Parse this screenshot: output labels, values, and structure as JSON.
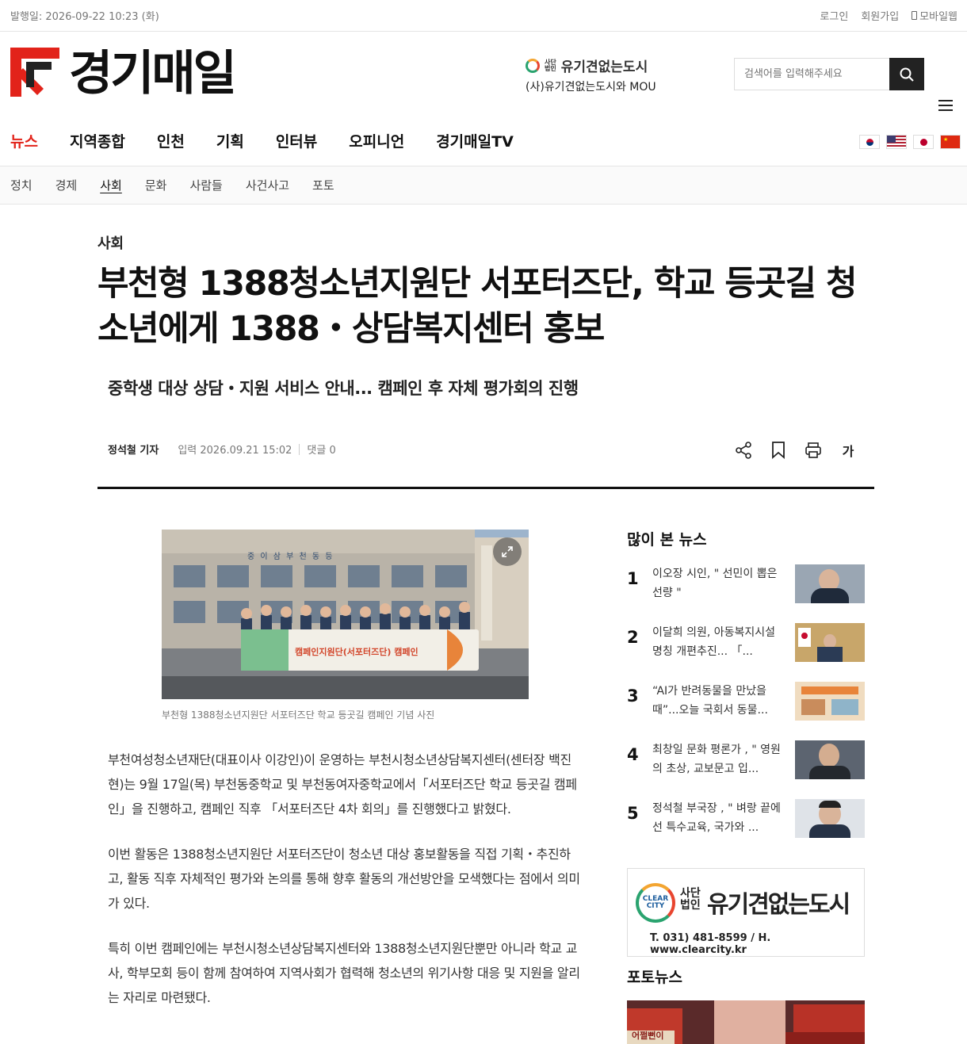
{
  "topbar": {
    "date": "발행일: 2026-09-22 10:23 (화)",
    "login": "로그인",
    "signup": "회원가입",
    "mobile": "모바일웹"
  },
  "header": {
    "logo": "경기매일",
    "mou_brand": "유기견없는도시",
    "mou_small_1": "사단",
    "mou_small_2": "법인",
    "mou_text": "(사)유기견없는도시와 MOU",
    "search_placeholder": "검색어를 입력해주세요"
  },
  "gnb": [
    "뉴스",
    "지역종합",
    "인천",
    "기획",
    "인터뷰",
    "오피니언",
    "경기매일TV"
  ],
  "subnav": [
    "정치",
    "경제",
    "사회",
    "문화",
    "사람들",
    "사건사고",
    "포토"
  ],
  "article": {
    "section": "사회",
    "headline": "부천형 1388청소년지원단 서포터즈단, 학교 등곳길 청소년에게 1388・상담복지센터 홍보",
    "subhead": "중학생 대상 상담・지원 서비스 안내... 캠페인 후 자체 평가회의 진행",
    "reporter": "정석철 기자",
    "date": "입력 2026.09.21 15:02",
    "comments": "댓글 0",
    "font_tool": "가",
    "caption": "부천형 1388청소년지원단 서포터즈단 학교 등곳길 캠페인 기념 사진",
    "banner_text": "캠페인지원단(서포터즈단) 캠페인",
    "building_text": "중 이 삼 부 천 동 등",
    "paragraphs": [
      "부천여성청소년재단(대표이사 이강인)이 운영하는 부천시청소년상담복지센터(센터장 백진현)는 9월 17일(목) 부천동중학교 및 부천동여자중학교에서「서포터즈단 학교 등곳길 캠페인」을 진행하고, 캠페인 직후 「서포터즈단 4차 회의」를 진행했다고 밝혔다.",
      "이번 활동은 1388청소년지원단 서포터즈단이 청소년 대상 홍보활동을 직접 기획・추진하고, 활동 직후 자체적인 평가와 논의를 통해 향후 활동의 개선방안을 모색했다는 점에서 의미가 있다.",
      "특히 이번 캠페인에는 부천시청소년상담복지센터와 1388청소년지원단뿐만 아니라 학교 교사, 학부모회 등이 함께 참여하여 지역사회가 협력해 청소년의 위기사항 대응 및 지원을 알리는 자리로 마련됐다."
    ]
  },
  "sidebar": {
    "popular_title": "많이 본 뉴스",
    "popular": [
      {
        "rank": "1",
        "title": "이오장 시인, \" 선민이 뽑은 선량 \""
      },
      {
        "rank": "2",
        "title": "이달희 의원, 아동복지시설 명칭 개편추진... 「..."
      },
      {
        "rank": "3",
        "title": "“AI가 반려동물을 만났을 때”...오늘 국회서 동물..."
      },
      {
        "rank": "4",
        "title": "최창일 문화 평론가 , \" 영원의 초상, 교보문고 입..."
      },
      {
        "rank": "5",
        "title": "정석철 부국장 , \" 벼랑 끝에 선 특수교육, 국가와 ..."
      }
    ],
    "banner_brand": "유기견없는도시",
    "banner_small_1": "사단",
    "banner_small_2": "법인",
    "banner_logo_1": "CLEAR",
    "banner_logo_2": "CITY",
    "banner_contact": "T. 031) 481-8599 / H. www.clearcity.kr",
    "photonews_title": "포토뉴스",
    "photonews_text": "어쩔뻔이"
  },
  "colors": {
    "accent": "#e2231a",
    "dark": "#111111"
  }
}
